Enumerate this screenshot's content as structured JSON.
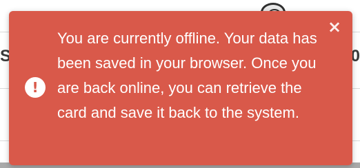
{
  "background": {
    "left_glyph": "S",
    "right_glyph": "0",
    "avatar_icon": "user-avatar-icon"
  },
  "toast": {
    "type": "error",
    "color": "#d9594a",
    "status_icon": "exclamation-circle-icon",
    "status_icon_glyph": "!",
    "message": "You are currently offline. Your data has been saved in your browser. Once you are back online, you can retrieve the card and save it back to the system.",
    "close_icon": "close-icon",
    "close_glyph": "×"
  }
}
